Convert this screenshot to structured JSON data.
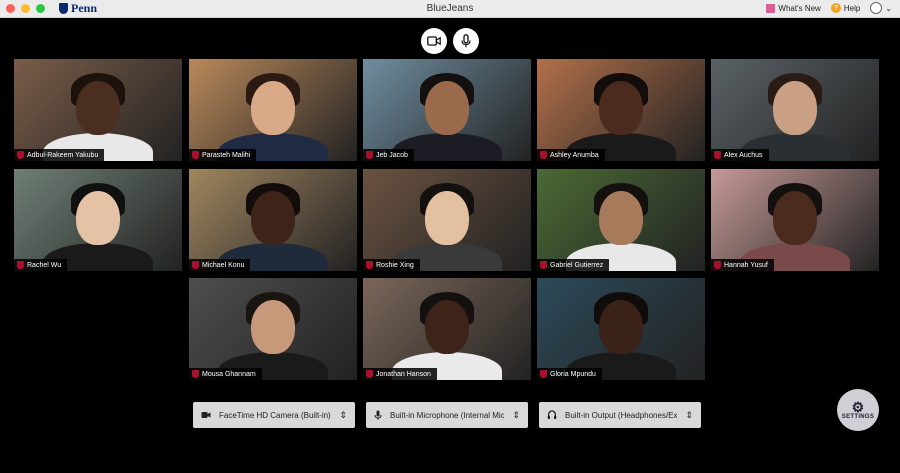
{
  "window": {
    "title": "BlueJeans",
    "logo_text": "Penn"
  },
  "topright": {
    "whats_new": "What's New",
    "help": "Help",
    "chevron": "⌄"
  },
  "controls": {
    "video_icon": "video-camera-icon",
    "mic_icon": "microphone-icon"
  },
  "participants": [
    {
      "name": "Adbul-Rakeem Yakubu",
      "bg": "#7a5c48",
      "skin": "#4a2e20",
      "hair": "#1c120c",
      "shirt": "#e8e8e8"
    },
    {
      "name": "Parasteh Malihi",
      "bg": "#b9895a",
      "skin": "#d9a987",
      "hair": "#2a1a12",
      "shirt": "#1f2a44"
    },
    {
      "name": "Jeb Jacob",
      "bg": "#6f8ea0",
      "skin": "#9b6a4c",
      "hair": "#141010",
      "shirt": "#1c1c24"
    },
    {
      "name": "Ashley Anumba",
      "bg": "#b3704a",
      "skin": "#4b2b1d",
      "hair": "#120c0a",
      "shirt": "#1a1a1a"
    },
    {
      "name": "Alex Auchus",
      "bg": "#5a6266",
      "skin": "#caa084",
      "hair": "#2a1c14",
      "shirt": "#2a2f34"
    },
    {
      "name": "Rachel Wu",
      "bg": "#6f7f75",
      "skin": "#e3c2a6",
      "hair": "#111010",
      "shirt": "#1a1a1a"
    },
    {
      "name": "Michael Konu",
      "bg": "#a08660",
      "skin": "#3e2418",
      "hair": "#120c0a",
      "shirt": "#1f2a3a"
    },
    {
      "name": "Roshie Xing",
      "bg": "#6b5240",
      "skin": "#e3c0a0",
      "hair": "#141010",
      "shirt": "#3a3a3a"
    },
    {
      "name": "Gabriel Gutierrez",
      "bg": "#4a6a35",
      "skin": "#a87a5c",
      "hair": "#141010",
      "shirt": "#e8e8e8"
    },
    {
      "name": "Hannah Yusuf",
      "bg": "#c59a97",
      "skin": "#4b2b1d",
      "hair": "#141010",
      "shirt": "#7a4a4a"
    },
    {
      "name": "Mousa Ghannam",
      "bg": "#4e4e4e",
      "skin": "#c8987a",
      "hair": "#1a1410",
      "shirt": "#1a1a1a"
    },
    {
      "name": "Jonathan Hanson",
      "bg": "#7a6658",
      "skin": "#3e2418",
      "hair": "#141010",
      "shirt": "#eaeaea"
    },
    {
      "name": "Gloria Mpundu",
      "bg": "#2c4a5a",
      "skin": "#3a2218",
      "hair": "#100c0a",
      "shirt": "#1a1a1a"
    }
  ],
  "devices": {
    "camera": {
      "label": "FaceTime HD Camera (Built-in)",
      "icon": "camera-icon"
    },
    "microphone": {
      "label": "Built-in Microphone (Internal Mic...",
      "icon": "microphone-icon"
    },
    "output": {
      "label": "Built-in Output (Headphones/Ex...",
      "icon": "headphones-icon"
    }
  },
  "settings": {
    "label": "SETTINGS"
  },
  "colors": {
    "accent": "#a8102e",
    "penn_blue": "#0b2a6b",
    "help_orange": "#f2a21b"
  }
}
